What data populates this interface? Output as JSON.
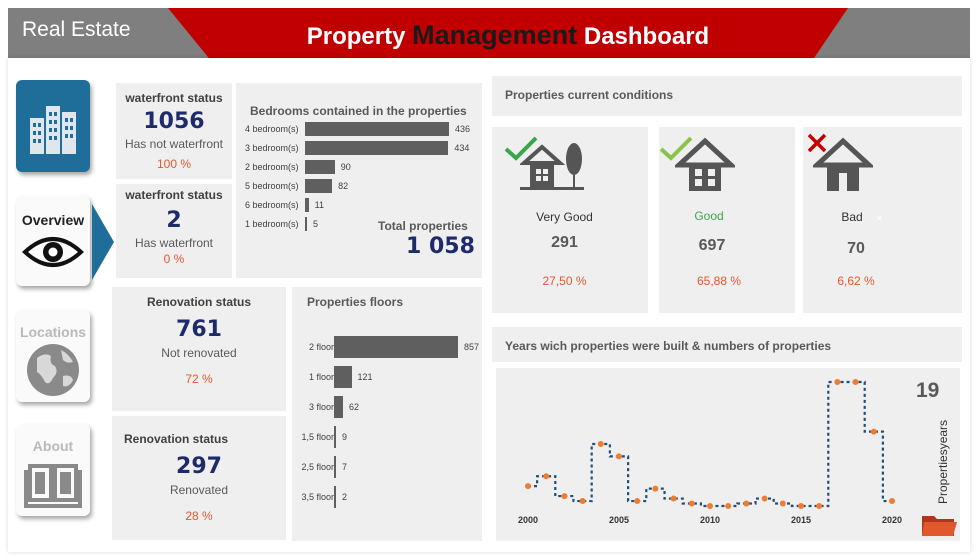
{
  "header": {
    "brand": "Real Estate",
    "title_pre": "Property ",
    "title_mid": "Management",
    "title_post": " Dashboard"
  },
  "nav": {
    "overview": "Overview",
    "locations": "Locations",
    "about": "About"
  },
  "waterfront_no": {
    "title": "waterfront status",
    "value": "1056",
    "label": "Has not waterfront",
    "pct": "100 %"
  },
  "waterfront_yes": {
    "title": "waterfront status",
    "value": "2",
    "label": "Has waterfront",
    "pct": "0 %"
  },
  "renov_no": {
    "title": "Renovation status",
    "value": "761",
    "label": "Not renovated",
    "pct": "72 %"
  },
  "renov_yes": {
    "title": "Renovation status",
    "value": "297",
    "label": "Renovated",
    "pct": "28 %"
  },
  "bedrooms": {
    "title": "Bedrooms contained in the properties",
    "total_label": "Total properties",
    "total_value": "1 058",
    "rows": [
      {
        "label": "4 bedroom(s)",
        "value": 436
      },
      {
        "label": "3 bedroom(s)",
        "value": 434
      },
      {
        "label": "2 bedroom(s)",
        "value": 90
      },
      {
        "label": "5 bedroom(s)",
        "value": 82
      },
      {
        "label": "6 bedroom(s)",
        "value": 11
      },
      {
        "label": "1 bedroom(s)",
        "value": 5
      }
    ]
  },
  "floors": {
    "title": "Properties floors",
    "rows": [
      {
        "label": "2 floor",
        "value": 857
      },
      {
        "label": "1 floor",
        "value": 121
      },
      {
        "label": "3 floor",
        "value": 62
      },
      {
        "label": "1,5 floor",
        "value": 9
      },
      {
        "label": "2,5 floor",
        "value": 7
      },
      {
        "label": "3,5 floor",
        "value": 2
      }
    ]
  },
  "conditions": {
    "title": "Properties current conditions",
    "very_good": {
      "label": "Very Good",
      "value": "291",
      "pct": "27,50 %"
    },
    "good": {
      "label": "Good",
      "value": "697",
      "pct": "65,88 %"
    },
    "bad": {
      "label": "Bad",
      "value": "70",
      "pct": "6,62 %",
      "close_mark": "×"
    }
  },
  "years": {
    "title": "Years wich properties were built & numbers of properties",
    "count": "19",
    "count_label": "Propertiesyears"
  },
  "chart_data": {
    "type": "line",
    "x": [
      2000,
      2001,
      2002,
      2003,
      2004,
      2005,
      2006,
      2007,
      2008,
      2009,
      2010,
      2011,
      2012,
      2013,
      2014,
      2015,
      2016,
      2017,
      2018,
      2019,
      2020
    ],
    "y": [
      8,
      12,
      4,
      2,
      25,
      20,
      2,
      7,
      3,
      1,
      0,
      0,
      1,
      3,
      1,
      0,
      0,
      50,
      50,
      30,
      2
    ],
    "xticks": [
      "2000",
      "2005",
      "2010",
      "2015",
      "2020"
    ],
    "title": "Years wich properties were built & numbers of properties"
  },
  "colors": {
    "accent_red": "#c00000",
    "header_gray": "#7f7f7f",
    "navy": "#1f2a6b",
    "orange": "#e2582e",
    "bar_gray": "#5f5f5f",
    "check_green": "#3aa64a"
  }
}
